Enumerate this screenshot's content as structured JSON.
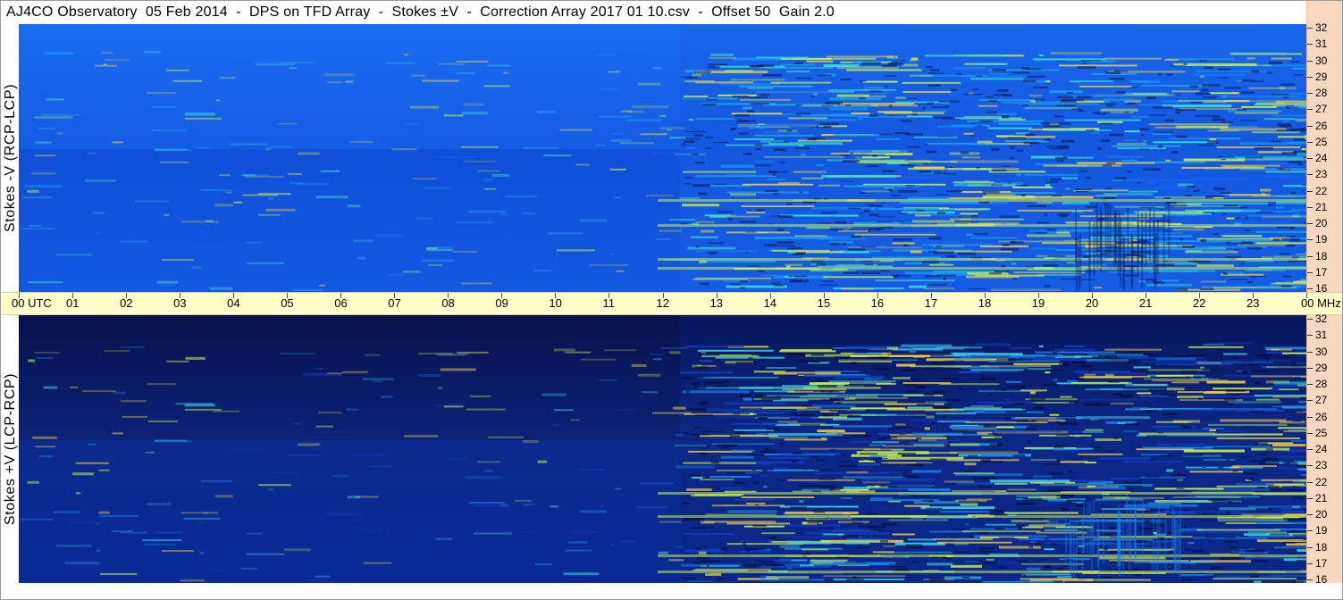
{
  "title": "AJ4CO Observatory  05 Feb 2014  -  DPS on TFD Array  -  Stokes ±V  -  Correction Array 2017 01 10.csv  -  Offset 50  Gain 2.0",
  "panels": [
    {
      "label": "Stokes -V (RCP-LCP)"
    },
    {
      "label": "Stokes +V (LCP-RCP)"
    }
  ],
  "chart_data": [
    {
      "type": "heatmap",
      "title": "AJ4CO Observatory  05 Feb 2014  -  DPS on TFD Array  -  Stokes ±V  -  Correction Array 2017 01 10.csv  -  Offset 50  Gain 2.0",
      "panel": "Stokes -V (RCP-LCP)",
      "xlabel": "UTC",
      "ylabel": "MHz",
      "x_ticks": [
        "00",
        "01",
        "02",
        "03",
        "04",
        "05",
        "06",
        "07",
        "08",
        "09",
        "10",
        "11",
        "12",
        "13",
        "14",
        "15",
        "16",
        "17",
        "18",
        "19",
        "20",
        "21",
        "22",
        "23",
        "00"
      ],
      "xlim": [
        0,
        24
      ],
      "y_ticks": [
        16,
        17,
        18,
        19,
        20,
        21,
        22,
        23,
        24,
        25,
        26,
        27,
        28,
        29,
        30,
        31,
        32
      ],
      "ylim": [
        16,
        32
      ],
      "colormap": [
        "#0a1450",
        "#0d3cb4",
        "#1464f0",
        "#1aa0f0",
        "#40e0d0",
        "#c8f050",
        "#f0d040",
        "#ff5030"
      ]
    },
    {
      "type": "heatmap",
      "panel": "Stokes +V (LCP-RCP)",
      "xlabel": "UTC",
      "ylabel": "MHz",
      "x_ticks": [
        "00",
        "01",
        "02",
        "03",
        "04",
        "05",
        "06",
        "07",
        "08",
        "09",
        "10",
        "11",
        "12",
        "13",
        "14",
        "15",
        "16",
        "17",
        "18",
        "19",
        "20",
        "21",
        "22",
        "23",
        "00"
      ],
      "xlim": [
        0,
        24
      ],
      "y_ticks": [
        16,
        17,
        18,
        19,
        20,
        21,
        22,
        23,
        24,
        25,
        26,
        27,
        28,
        29,
        30,
        31,
        32
      ],
      "ylim": [
        16,
        32
      ],
      "colormap": [
        "#05082a",
        "#0a1e78",
        "#1440c8",
        "#1a80e8",
        "#40d0e0",
        "#c8f050",
        "#f0d040",
        "#ff5030"
      ]
    }
  ],
  "axis": {
    "utc_label": "UTC",
    "mhz_label": "MHz"
  }
}
